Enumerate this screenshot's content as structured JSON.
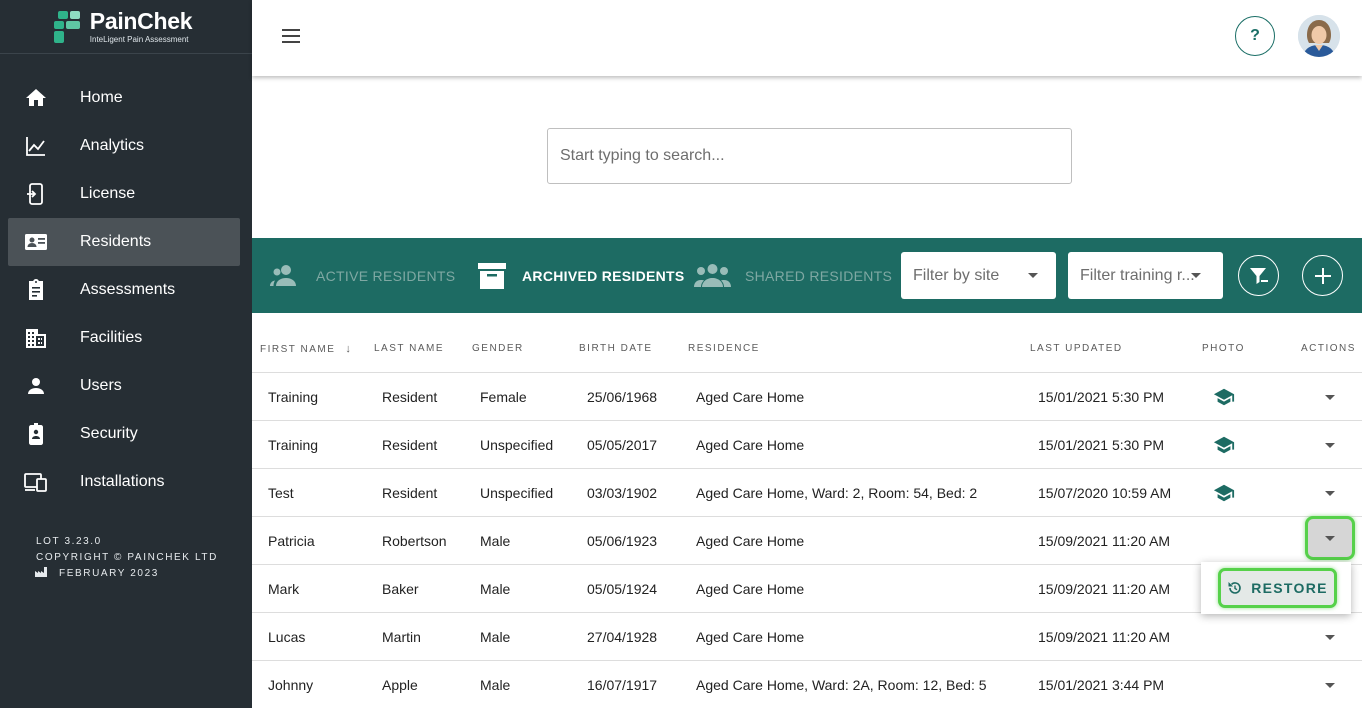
{
  "brand": {
    "name": "PainChek",
    "tagline": "InteLigent Pain Assessment"
  },
  "sidebar": {
    "items": [
      {
        "label": "Home",
        "icon": "home-icon"
      },
      {
        "label": "Analytics",
        "icon": "analytics-icon"
      },
      {
        "label": "License",
        "icon": "license-icon"
      },
      {
        "label": "Residents",
        "icon": "residents-icon",
        "active": true
      },
      {
        "label": "Assessments",
        "icon": "assessments-icon"
      },
      {
        "label": "Facilities",
        "icon": "facilities-icon"
      },
      {
        "label": "Users",
        "icon": "users-icon"
      },
      {
        "label": "Security",
        "icon": "security-icon"
      },
      {
        "label": "Installations",
        "icon": "installations-icon"
      }
    ],
    "version": "LOT 3.23.0",
    "copyright": "COPYRIGHT © PAINCHEK LTD",
    "release_date": "FEBRUARY 2023"
  },
  "topbar": {
    "help_label": "?"
  },
  "search": {
    "placeholder": "Start typing to search..."
  },
  "toolbar": {
    "tabs": [
      {
        "label": "ACTIVE RESIDENTS",
        "active": false
      },
      {
        "label": "ARCHIVED RESIDENTS",
        "active": true
      },
      {
        "label": "SHARED RESIDENTS",
        "active": false
      }
    ],
    "filter_site_placeholder": "Filter by site",
    "filter_training_placeholder": "Filter training r..."
  },
  "table": {
    "columns": {
      "first_name": "FIRST NAME",
      "last_name": "LAST NAME",
      "gender": "GENDER",
      "birth_date": "BIRTH DATE",
      "residence": "RESIDENCE",
      "last_updated": "LAST UPDATED",
      "photo": "PHOTO",
      "actions": "ACTIONS"
    },
    "rows": [
      {
        "first_name": "Training",
        "last_name": "Resident",
        "gender": "Female",
        "birth_date": "25/06/1968",
        "residence": "Aged Care Home",
        "last_updated": "15/01/2021 5:30 PM",
        "photo": "training-icon"
      },
      {
        "first_name": "Training",
        "last_name": "Resident",
        "gender": "Unspecified",
        "birth_date": "05/05/2017",
        "residence": "Aged Care Home",
        "last_updated": "15/01/2021 5:30 PM",
        "photo": "training-icon"
      },
      {
        "first_name": "Test",
        "last_name": "Resident",
        "gender": "Unspecified",
        "birth_date": "03/03/1902",
        "residence": "Aged Care Home, Ward: 2, Room: 54, Bed: 2",
        "last_updated": "15/07/2020 10:59 AM",
        "photo": "training-icon"
      },
      {
        "first_name": "Patricia",
        "last_name": "Robertson",
        "gender": "Male",
        "birth_date": "05/06/1923",
        "residence": "Aged Care Home",
        "last_updated": "15/09/2021 11:20 AM",
        "photo": ""
      },
      {
        "first_name": "Mark",
        "last_name": "Baker",
        "gender": "Male",
        "birth_date": "05/05/1924",
        "residence": "Aged Care Home",
        "last_updated": "15/09/2021 11:20 AM",
        "photo": ""
      },
      {
        "first_name": "Lucas",
        "last_name": "Martin",
        "gender": "Male",
        "birth_date": "27/04/1928",
        "residence": "Aged Care Home",
        "last_updated": "15/09/2021 11:20 AM",
        "photo": ""
      },
      {
        "first_name": "Johnny",
        "last_name": "Apple",
        "gender": "Male",
        "birth_date": "16/07/1917",
        "residence": "Aged Care Home, Ward: 2A, Room: 12, Bed: 5",
        "last_updated": "15/01/2021 3:44 PM",
        "photo": ""
      }
    ]
  },
  "popup": {
    "restore_label": "RESTORE"
  },
  "colors": {
    "sidebar_bg": "#262e34",
    "brand_green": "#1d6b63",
    "highlight": "#56d14a"
  }
}
